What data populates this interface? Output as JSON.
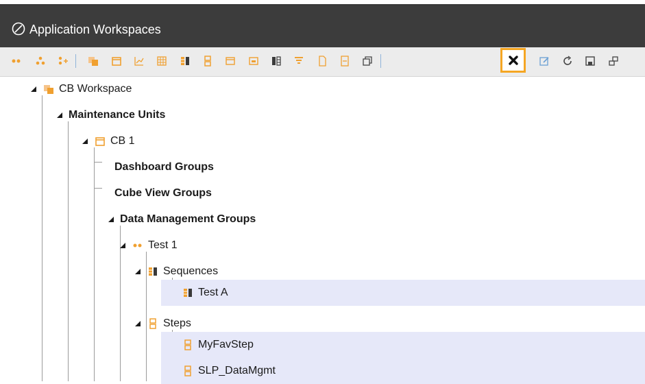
{
  "window": {
    "title": "Application Workspaces",
    "title_icon": "onestream-logo-icon"
  },
  "toolbar": {
    "icons": [
      "dm-group-icon",
      "dm-group-add-icon",
      "dm-step-add-icon",
      "workspace-icon",
      "maintenance-unit-icon",
      "chart-icon",
      "grid-icon",
      "sequence-icon",
      "step-icon",
      "report-icon",
      "list-icon",
      "parameter-icon",
      "filter-icon",
      "file-icon",
      "document-icon",
      "copy-icon",
      "delete-icon",
      "edit-icon",
      "refresh-icon",
      "save-icon",
      "more-icon"
    ],
    "highlighted": "delete-icon",
    "highlight_color": "#f5a623"
  },
  "tree": {
    "workspace": "CB Workspace",
    "maintenance_units": "Maintenance Units",
    "unit": "CB 1",
    "dashboard_groups": "Dashboard Groups",
    "cube_view_groups": "Cube View Groups",
    "dm_groups": "Data Management Groups",
    "group": "Test 1",
    "sequences": "Sequences",
    "sequence_item": "Test A",
    "steps": "Steps",
    "step_1": "MyFavStep",
    "step_2": "SLP_DataMgmt"
  },
  "colors": {
    "accent_orange": "#f0a030",
    "selection": "#e6e8f9",
    "titlebar": "#3c3c3c"
  }
}
